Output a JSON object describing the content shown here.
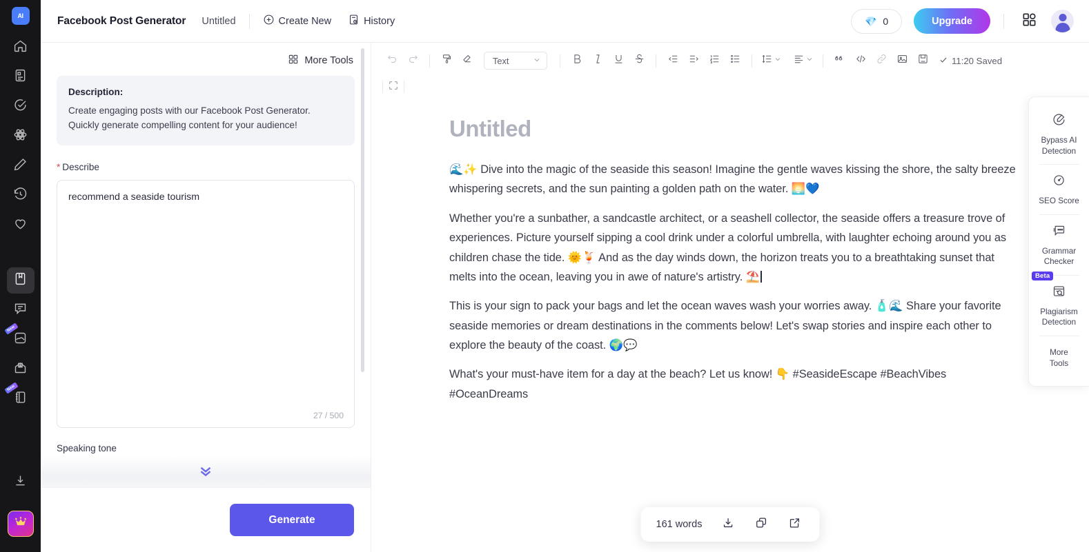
{
  "rail": {
    "logo_label": "AI",
    "items": [
      {
        "name": "home-icon",
        "badge": null
      },
      {
        "name": "document-icon",
        "badge": null
      },
      {
        "name": "check-circle-icon",
        "badge": null
      },
      {
        "name": "atom-icon",
        "badge": null
      },
      {
        "name": "pencil-icon",
        "badge": null
      },
      {
        "name": "history-icon",
        "badge": null
      },
      {
        "name": "heart-icon",
        "badge": null
      },
      {
        "name": "bookmark-icon",
        "badge": null
      },
      {
        "name": "chat-icon",
        "badge": null
      },
      {
        "name": "image-icon",
        "badge": "New"
      },
      {
        "name": "inbox-icon",
        "badge": null
      },
      {
        "name": "notebook-icon",
        "badge": "New"
      }
    ],
    "download_icon": "download-icon",
    "crown_icon": "crown-icon"
  },
  "header": {
    "app_title": "Facebook Post Generator",
    "doc_name": "Untitled",
    "create_new": "Create New",
    "history": "History",
    "credits": "0",
    "credits_icon": "diamond-icon",
    "upgrade": "Upgrade",
    "apps_icon": "grid-apps-icon",
    "avatar": "user-avatar"
  },
  "form": {
    "more_tools": "More Tools",
    "description_title": "Description:",
    "description_text": "Create engaging posts with our Facebook Post Generator. Quickly generate compelling content for your audience!",
    "describe_label": "Describe",
    "describe_value": "recommend a seaside tourism",
    "describe_placeholder": "Describe",
    "char_count": "27 / 500",
    "tone_label": "Speaking tone",
    "generate": "Generate"
  },
  "toolbar": {
    "format_value": "Text",
    "saved_status": "11:20 Saved",
    "buttons": [
      "undo-icon",
      "redo-icon",
      "format-paint-icon",
      "eraser-icon",
      "bold-icon",
      "italic-icon",
      "underline-icon",
      "strikethrough-icon",
      "outdent-icon",
      "indent-icon",
      "ordered-list-icon",
      "bullet-list-icon",
      "line-height-icon",
      "align-icon",
      "quote-icon",
      "code-icon",
      "link-icon",
      "image-icon",
      "save-icon"
    ],
    "fullscreen_icon": "fullscreen-icon"
  },
  "document": {
    "title": "Untitled",
    "paragraphs": [
      "🌊✨ Dive into the magic of the seaside this season! Imagine the gentle waves kissing the shore, the salty breeze whispering secrets, and the sun painting a golden path on the water. 🌅💙",
      "Whether you're a sunbather, a sandcastle architect, or a seashell collector, the seaside offers a treasure trove of experiences. Picture yourself sipping a cool drink under a colorful umbrella, with laughter echoing around you as children chase the tide. 🌞🍹 And as the day winds down, the horizon treats you to a breathtaking sunset that melts into the ocean, leaving you in awe of nature's artistry. ⛱️",
      "This is your sign to pack your bags and let the ocean waves wash your worries away. 🧴🌊 Share your favorite seaside memories or dream destinations in the comments below! Let's swap stories and inspire each other to explore the beauty of the coast. 🌍💬",
      "What's your must-have item for a day at the beach? Let us know! 👇 #SeasideEscape #BeachVibes #OceanDreams"
    ]
  },
  "tools_panel": {
    "items": [
      {
        "label_line1": "Bypass AI",
        "label_line2": "Detection",
        "icon": "bypass-ai-icon",
        "badge": null
      },
      {
        "label_line1": "SEO Score",
        "label_line2": "",
        "icon": "seo-gauge-icon",
        "badge": null
      },
      {
        "label_line1": "Grammar",
        "label_line2": "Checker",
        "icon": "grammar-icon",
        "badge": null
      },
      {
        "label_line1": "Plagiarism",
        "label_line2": "Detection",
        "icon": "plagiarism-icon",
        "badge": "Beta"
      },
      {
        "label_line1": "More",
        "label_line2": "Tools",
        "icon": null,
        "badge": null
      }
    ]
  },
  "word_bar": {
    "word_count": "161 words",
    "download_icon": "download-icon",
    "copy_icon": "copy-icon",
    "export_icon": "external-link-icon"
  },
  "colors": {
    "accent": "#5b57ea",
    "rail_bg": "#161618",
    "beta_badge": "#5b3df0"
  }
}
